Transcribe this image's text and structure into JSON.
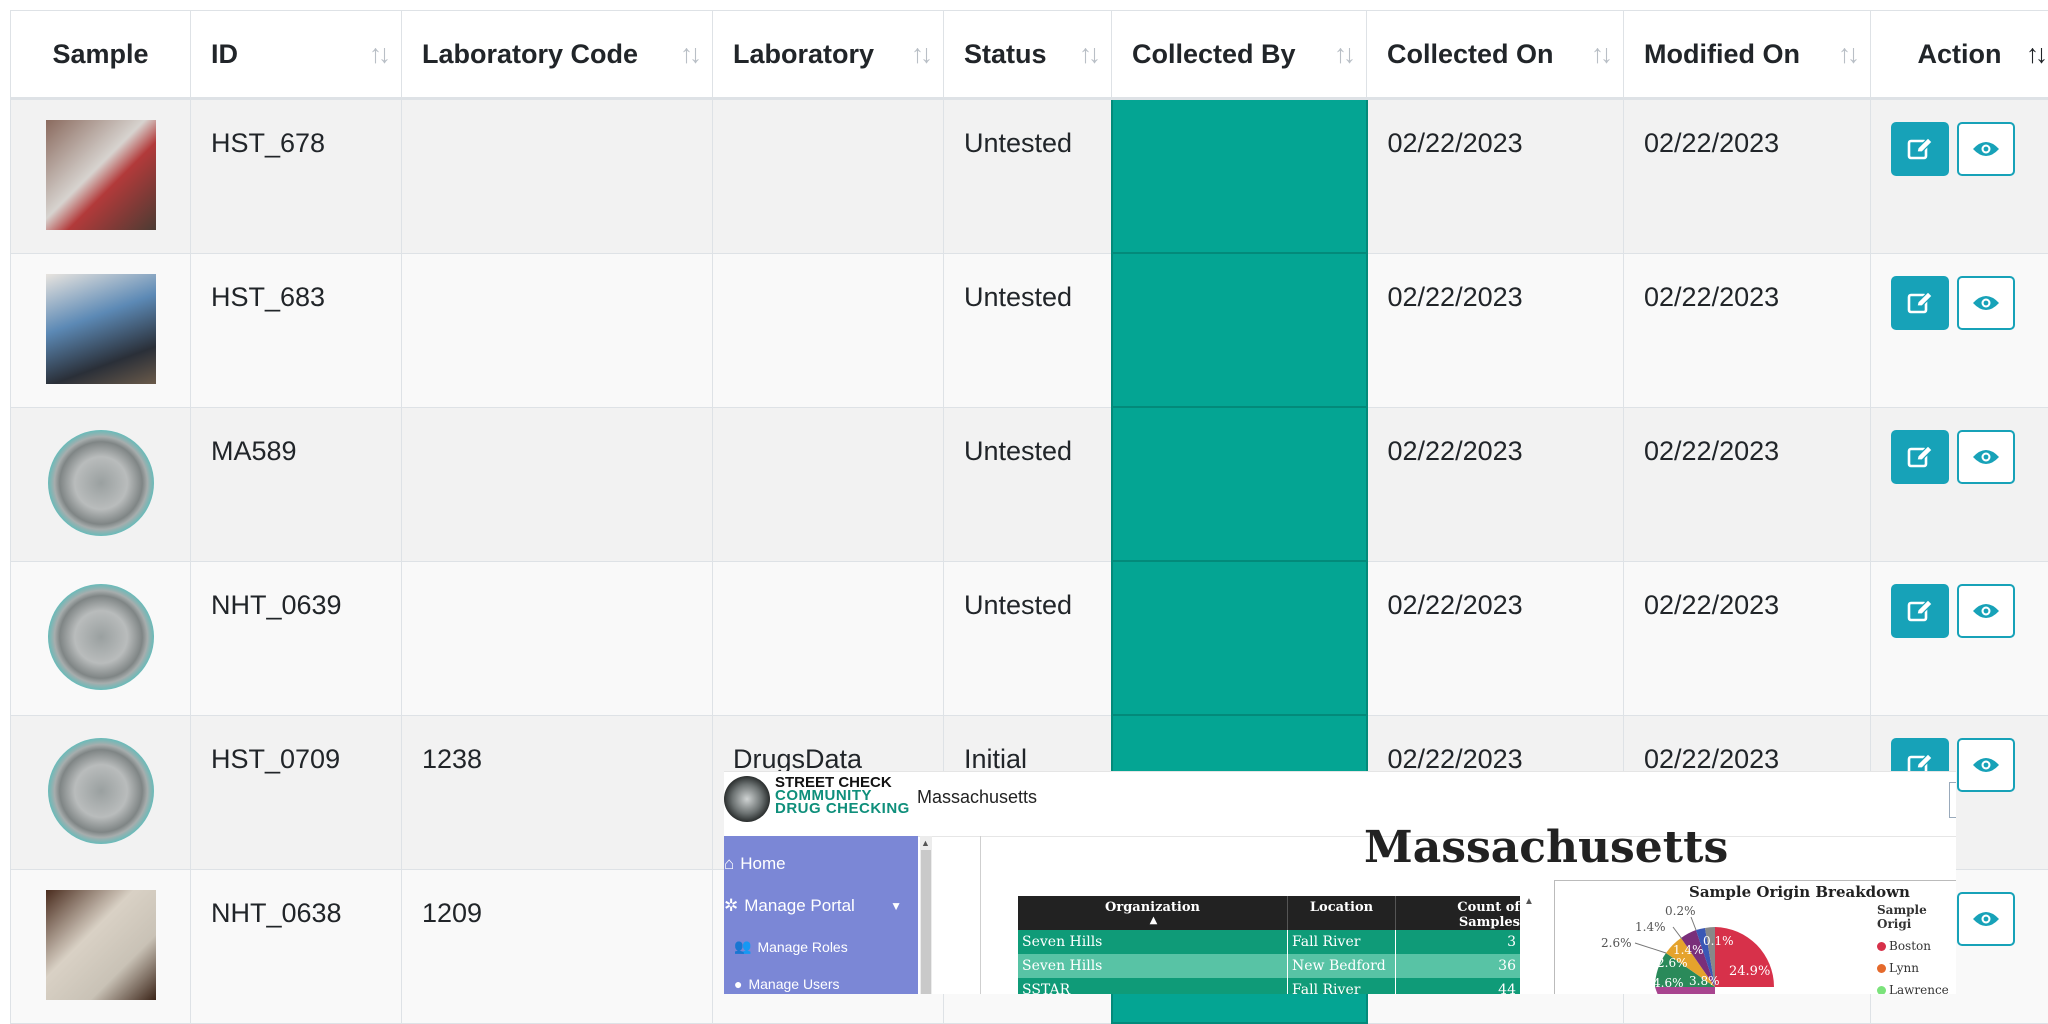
{
  "table": {
    "headers": {
      "sample": "Sample",
      "id": "ID",
      "lab_code": "Laboratory Code",
      "laboratory": "Laboratory",
      "status": "Status",
      "collected_by": "Collected By",
      "collected_on": "Collected On",
      "modified_on": "Modified On",
      "action": "Action"
    },
    "sort_icon": "↑↓",
    "rows": [
      {
        "id": "HST_678",
        "lab_code": "",
        "laboratory": "",
        "status": "Untested",
        "collected_by": "",
        "collected_on": "02/22/2023",
        "modified_on": "02/22/2023"
      },
      {
        "id": "HST_683",
        "lab_code": "",
        "laboratory": "",
        "status": "Untested",
        "collected_by": "",
        "collected_on": "02/22/2023",
        "modified_on": "02/22/2023"
      },
      {
        "id": "MA589",
        "lab_code": "",
        "laboratory": "",
        "status": "Untested",
        "collected_by": "",
        "collected_on": "02/22/2023",
        "modified_on": "02/22/2023"
      },
      {
        "id": "NHT_0639",
        "lab_code": "",
        "laboratory": "",
        "status": "Untested",
        "collected_by": "",
        "collected_on": "02/22/2023",
        "modified_on": "02/22/2023"
      },
      {
        "id": "HST_0709",
        "lab_code": "1238",
        "laboratory": "DrugsData",
        "status": "Initial",
        "collected_by": "",
        "collected_on": "02/22/2023",
        "modified_on": "02/22/2023"
      },
      {
        "id": "NHT_0638",
        "lab_code": "1209",
        "laboratory": "",
        "status": "",
        "collected_by": "",
        "collected_on": "",
        "modified_on": ""
      }
    ],
    "collected_by_color": "#04a593",
    "button_color": "#17a2b8",
    "icons": {
      "edit": "edit-icon",
      "view": "eye-icon"
    }
  },
  "overlay": {
    "logo": {
      "line1": "STREET CHECK",
      "line2": "COMMUNITY",
      "line3": "DRUG CHECKING"
    },
    "state_label": "Massachusetts",
    "nav": {
      "home": "Home",
      "manage_portal": "Manage Portal",
      "manage_roles": "Manage Roles",
      "manage_users": "Manage Users"
    },
    "sidebar_color": "#7b87d6",
    "dashboard_title": "Massachusetts",
    "org_table": {
      "headers": {
        "organization": "Organization",
        "location": "Location",
        "count": "Count of Samples"
      },
      "rows": [
        {
          "organization": "Seven Hills",
          "location": "Fall River",
          "count": "3"
        },
        {
          "organization": "Seven Hills",
          "location": "New Bedford",
          "count": "36"
        },
        {
          "organization": "SSTAR",
          "location": "Fall River",
          "count": "44"
        }
      ]
    },
    "pie": {
      "title": "Sample Origin Breakdown",
      "legend_title": "Sample Origi",
      "legend": [
        {
          "name": "Boston",
          "color": "#d7314a"
        },
        {
          "name": "Lynn",
          "color": "#e56a2c"
        },
        {
          "name": "Lawrence",
          "color": "#7be37b"
        }
      ],
      "labels": {
        "a": "24.9%",
        "b": "0.2%",
        "c": "1.4%",
        "d": "0.1%",
        "e": "1.4%",
        "f": "2.6%",
        "g": "2.6%",
        "h": "4.6%",
        "i": "3.8%"
      }
    }
  }
}
